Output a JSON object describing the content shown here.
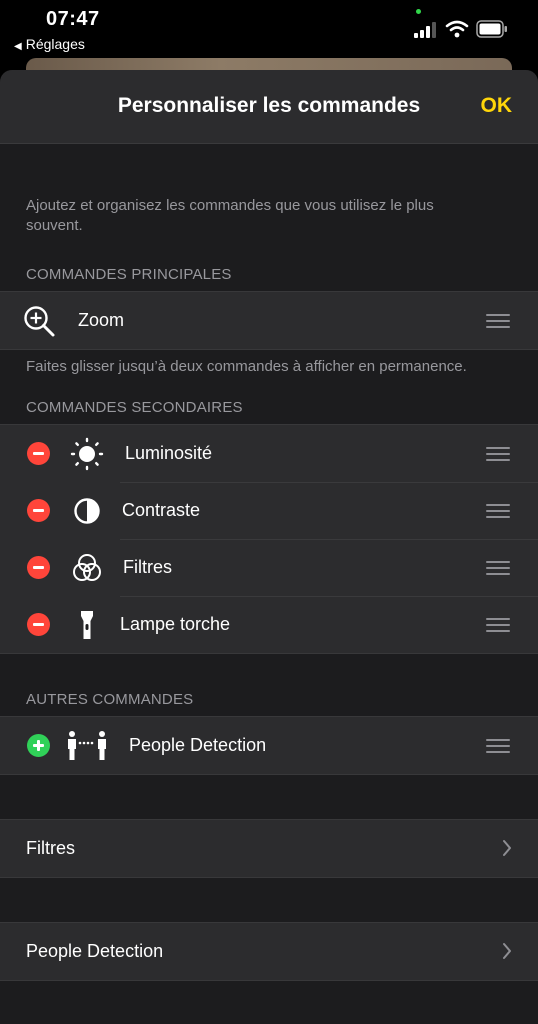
{
  "status_bar": {
    "time": "07:47",
    "back_label": "Réglages"
  },
  "nav": {
    "title": "Personnaliser les commandes",
    "ok_label": "OK"
  },
  "description": "Ajoutez et organisez les commandes que vous utilisez le plus souvent.",
  "primary": {
    "header": "COMMANDES PRINCIPALES",
    "items": [
      {
        "label": "Zoom",
        "icon": "zoom-in-icon"
      }
    ],
    "footnote": "Faites glisser jusqu’à deux commandes à afficher en permanence."
  },
  "secondary": {
    "header": "COMMANDES SECONDAIRES",
    "items": [
      {
        "label": "Luminosité",
        "icon": "brightness-icon"
      },
      {
        "label": "Contraste",
        "icon": "contrast-icon"
      },
      {
        "label": "Filtres",
        "icon": "filters-icon"
      },
      {
        "label": "Lampe torche",
        "icon": "flashlight-icon"
      }
    ]
  },
  "other": {
    "header": "AUTRES COMMANDES",
    "items": [
      {
        "label": "People Detection",
        "icon": "people-detection-icon"
      }
    ]
  },
  "links": [
    {
      "label": "Filtres"
    },
    {
      "label": "People Detection"
    }
  ],
  "colors": {
    "accent": "#ffd60a",
    "remove": "#ff453a",
    "add": "#30d158",
    "cell_bg": "#2c2c2e",
    "sheet_bg": "#1c1c1e"
  }
}
